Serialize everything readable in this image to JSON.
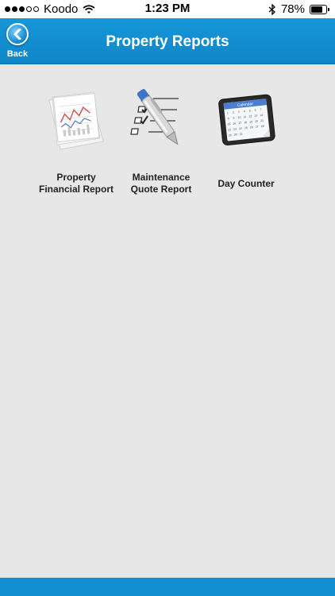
{
  "status_bar": {
    "carrier": "Koodo",
    "time": "1:23 PM",
    "battery": "78%",
    "battery_level": 0.78,
    "signal_bars_filled": 3,
    "signal_bars_total": 5
  },
  "nav": {
    "title": "Property Reports",
    "back_label": "Back"
  },
  "tiles": [
    {
      "line1": "Property",
      "line2": "Financial Report",
      "icon": "financial-report-icon"
    },
    {
      "line1": "Maintenance",
      "line2": "Quote Report",
      "icon": "checklist-pen-icon"
    },
    {
      "line1": "Day Counter",
      "line2": "",
      "icon": "calendar-tablet-icon"
    }
  ],
  "calendar_header": "Calendar",
  "colors": {
    "nav_blue": "#1597d8",
    "bottom_bar": "#1390d3",
    "background": "#e7e7e7"
  }
}
